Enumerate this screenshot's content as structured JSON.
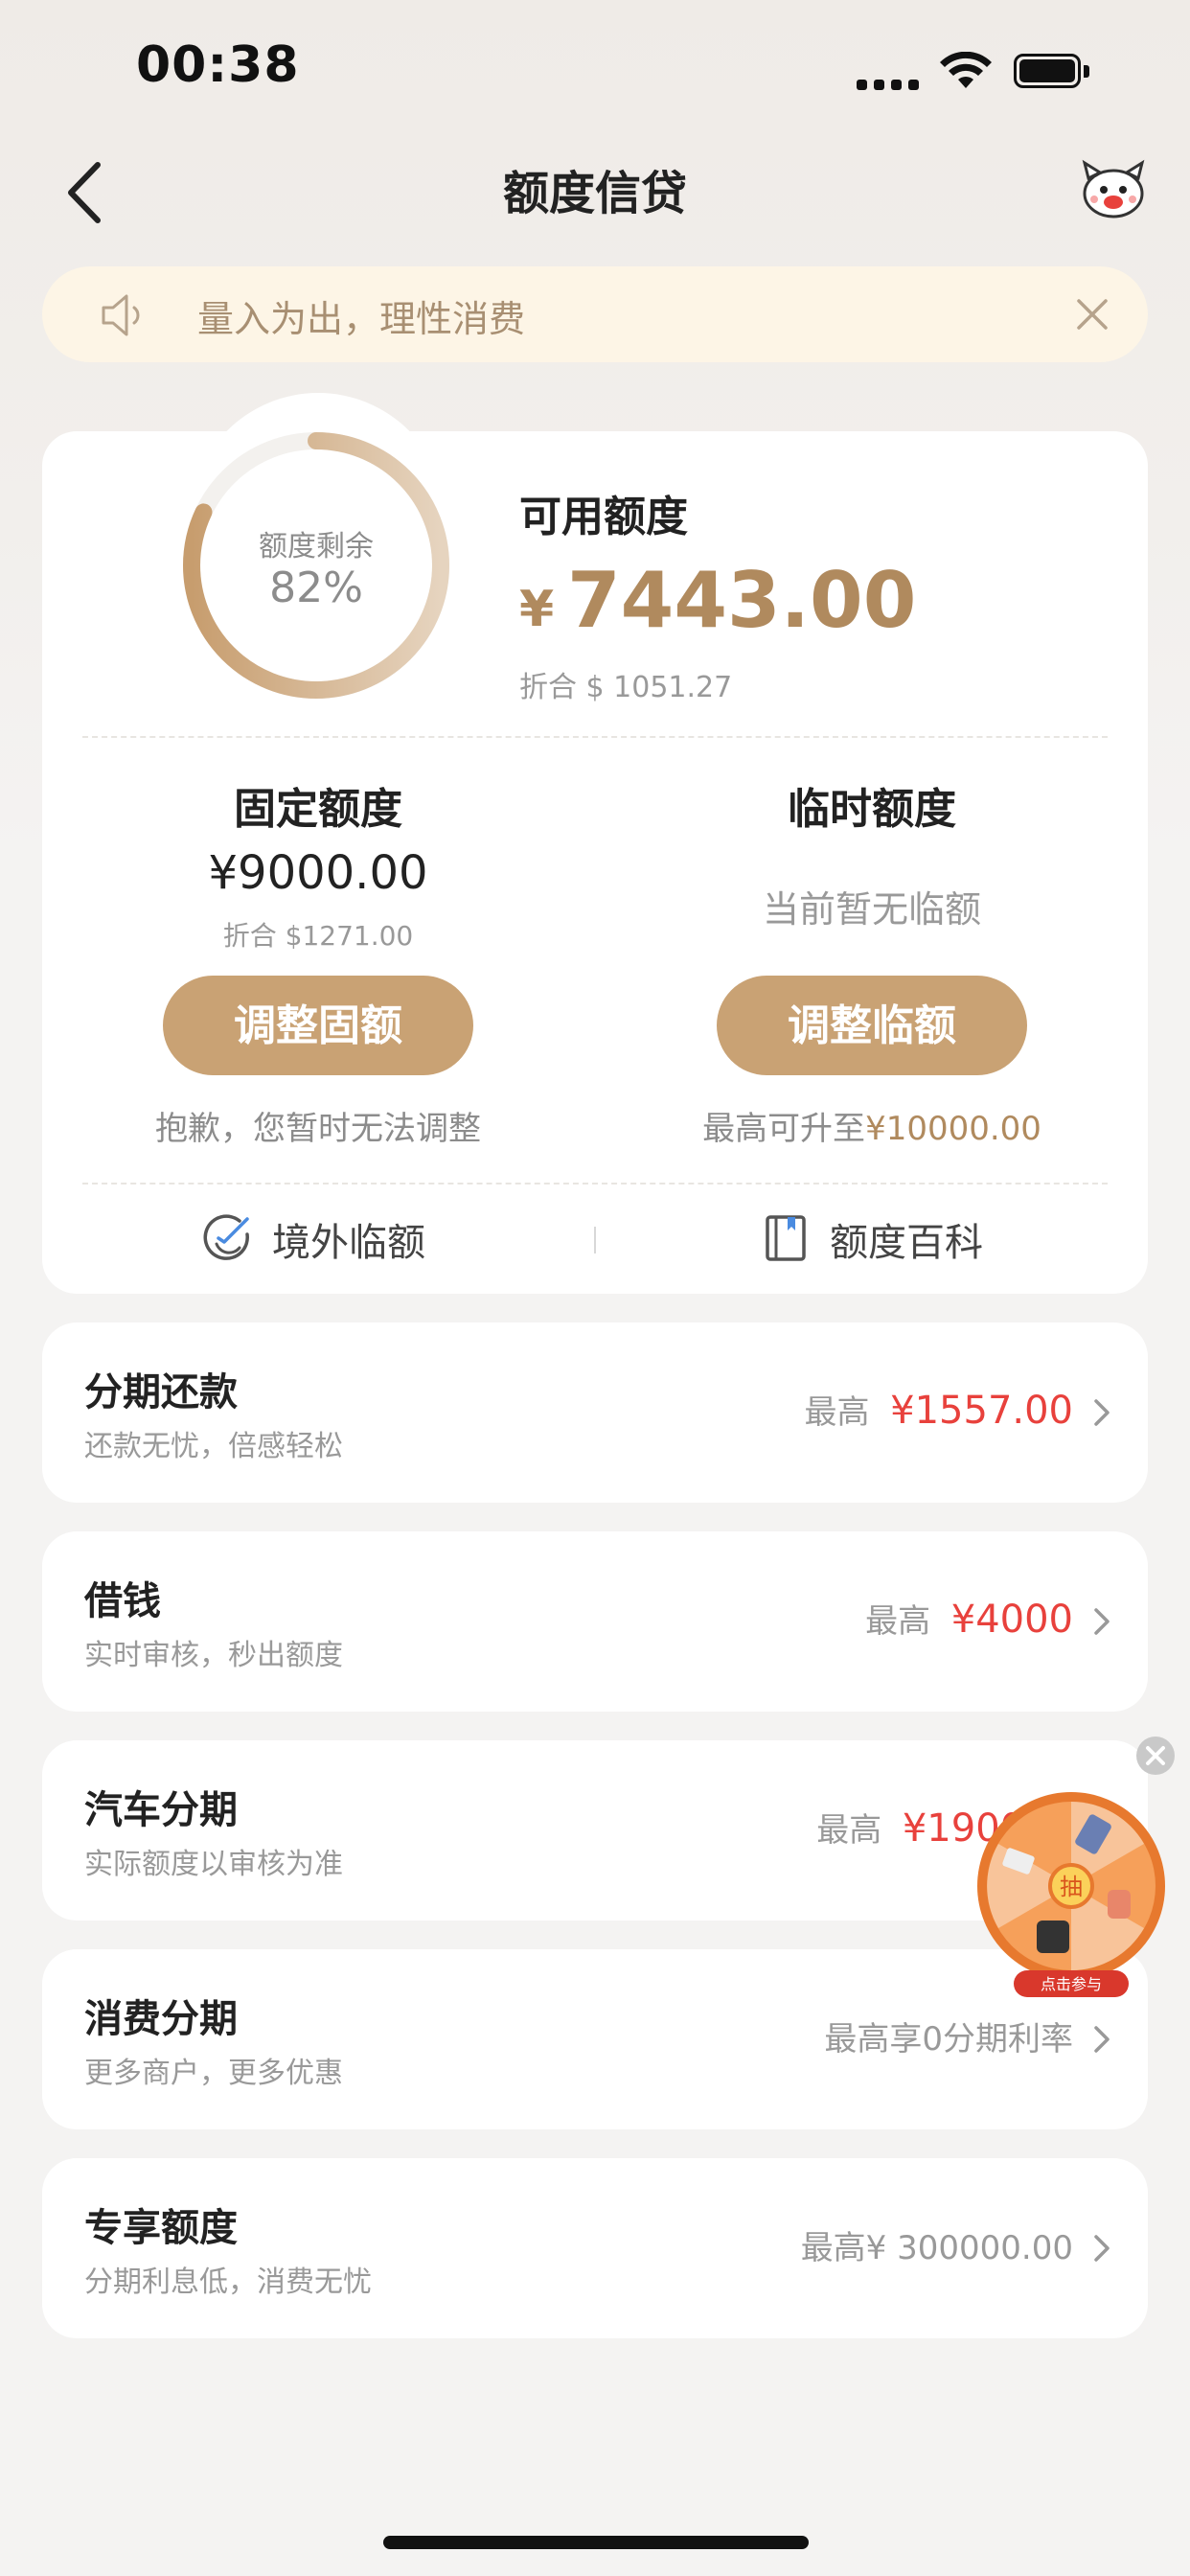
{
  "status_bar": {
    "time": "00:38"
  },
  "nav": {
    "title": "额度信贷"
  },
  "notice": {
    "text": "量入为出，理性消费"
  },
  "credit": {
    "ring_label": "额度剩余",
    "ring_percent": "82%",
    "ring_fraction": 0.82,
    "available_label": "可用额度",
    "currency_symbol": "¥",
    "available_amount": "7443.00",
    "available_usd": "折合 $ 1051.27"
  },
  "fixed": {
    "title": "固定额度",
    "amount": "¥9000.00",
    "usd": "折合 $1271.00",
    "button": "调整固额",
    "note": "抱歉，您暂时无法调整"
  },
  "temporary": {
    "title": "临时额度",
    "status": "当前暂无临额",
    "button": "调整临额",
    "note_prefix": "最高可升至",
    "note_amount": "¥10000.00"
  },
  "links": {
    "overseas": "境外临额",
    "wiki": "额度百科"
  },
  "products": [
    {
      "title": "分期还款",
      "subtitle": "还款无忧，倍感轻松",
      "prefix": "最高",
      "amount": "¥1557.00"
    },
    {
      "title": "借钱",
      "subtitle": "实时审核，秒出额度",
      "prefix": "最高",
      "amount": "¥4000"
    },
    {
      "title": "汽车分期",
      "subtitle": "实际额度以审核为准",
      "prefix": "最高",
      "amount": "¥190000"
    },
    {
      "title": "消费分期",
      "subtitle": "更多商户，更多优惠",
      "prefix": "最高享0分期利率",
      "amount": ""
    },
    {
      "title": "专享额度",
      "subtitle": "分期利息低，消费无忧",
      "prefix": "最高¥ 300000.00",
      "amount": ""
    }
  ],
  "promo": {
    "center": "抽",
    "ribbon": "点击参与"
  },
  "colors": {
    "accent": "#c9a274",
    "gold_text": "#b08a5e",
    "red": "#e8413c"
  }
}
